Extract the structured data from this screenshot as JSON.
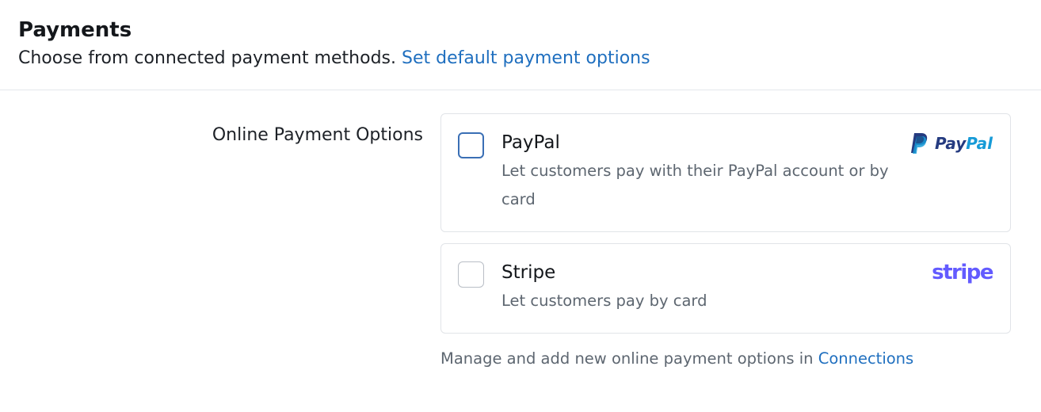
{
  "header": {
    "title": "Payments",
    "subtitle": "Choose from connected payment methods.",
    "subtitle_link": "Set default payment options"
  },
  "online_options": {
    "section_label": "Online Payment Options",
    "options": [
      {
        "name": "PayPal",
        "description": "Let customers pay with their PayPal account or by card",
        "logo_text_pay": "Pay",
        "logo_text_pal": "Pal",
        "logo_icon": "paypal-logo",
        "checked": false,
        "focused": true
      },
      {
        "name": "Stripe",
        "description": "Let customers pay by card",
        "logo_text": "stripe",
        "logo_icon": "stripe-logo",
        "checked": false,
        "focused": false
      }
    ],
    "footer_text": "Manage and add new online payment options in",
    "footer_link": "Connections"
  },
  "colors": {
    "link": "#1f6fbf",
    "paypal_dark": "#253b80",
    "paypal_light": "#179bd7",
    "stripe_brand": "#635bff",
    "focus_border": "#3a6fb5"
  }
}
